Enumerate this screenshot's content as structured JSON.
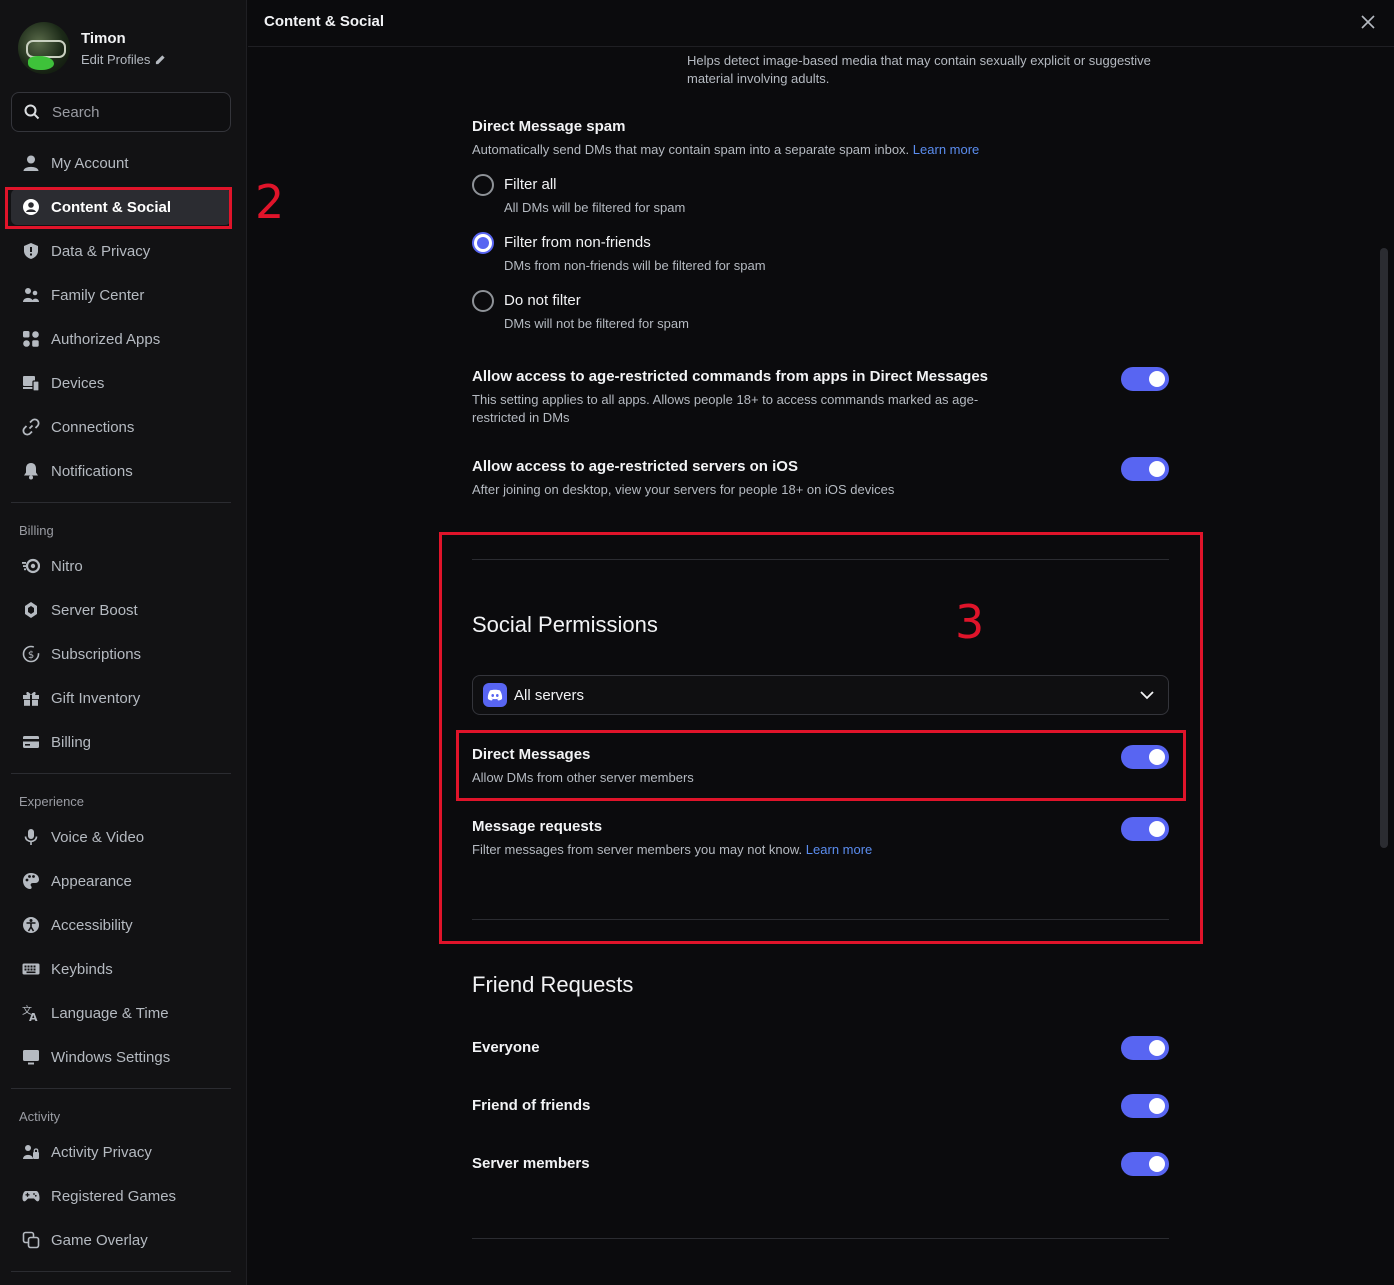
{
  "profile": {
    "name": "Timon",
    "edit_label": "Edit Profiles"
  },
  "search": {
    "placeholder": "Search"
  },
  "nav": {
    "user_items": [
      {
        "label": "My Account",
        "icon": "person-icon"
      },
      {
        "label": "Content & Social",
        "icon": "content-social-icon",
        "active": true
      },
      {
        "label": "Data & Privacy",
        "icon": "shield-icon"
      },
      {
        "label": "Family Center",
        "icon": "family-icon"
      },
      {
        "label": "Authorized Apps",
        "icon": "apps-icon"
      },
      {
        "label": "Devices",
        "icon": "devices-icon"
      },
      {
        "label": "Connections",
        "icon": "link-icon"
      },
      {
        "label": "Notifications",
        "icon": "bell-icon"
      }
    ],
    "billing_label": "Billing",
    "billing_items": [
      {
        "label": "Nitro",
        "icon": "nitro-icon"
      },
      {
        "label": "Server Boost",
        "icon": "boost-icon"
      },
      {
        "label": "Subscriptions",
        "icon": "subscriptions-icon"
      },
      {
        "label": "Gift Inventory",
        "icon": "gift-icon"
      },
      {
        "label": "Billing",
        "icon": "card-icon"
      }
    ],
    "experience_label": "Experience",
    "experience_items": [
      {
        "label": "Voice & Video",
        "icon": "mic-icon"
      },
      {
        "label": "Appearance",
        "icon": "palette-icon"
      },
      {
        "label": "Accessibility",
        "icon": "accessibility-icon"
      },
      {
        "label": "Keybinds",
        "icon": "keyboard-icon"
      },
      {
        "label": "Language & Time",
        "icon": "language-icon"
      },
      {
        "label": "Windows Settings",
        "icon": "monitor-icon"
      }
    ],
    "activity_label": "Activity",
    "activity_items": [
      {
        "label": "Activity Privacy",
        "icon": "activity-icon"
      },
      {
        "label": "Registered Games",
        "icon": "gamepad-icon"
      },
      {
        "label": "Game Overlay",
        "icon": "overlay-icon"
      }
    ]
  },
  "header": {
    "title": "Content & Social"
  },
  "content": {
    "top_desc": "Helps detect image-based media that may contain sexually explicit or suggestive material involving adults.",
    "dm_spam": {
      "title": "Direct Message spam",
      "desc": "Automatically send DMs that may contain spam into a separate spam inbox.",
      "learn_more": "Learn more",
      "options": [
        {
          "label": "Filter all",
          "desc": "All DMs will be filtered for spam",
          "selected": false
        },
        {
          "label": "Filter from non-friends",
          "desc": "DMs from non-friends will be filtered for spam",
          "selected": true
        },
        {
          "label": "Do not filter",
          "desc": "DMs will not be filtered for spam",
          "selected": false
        }
      ]
    },
    "age_commands": {
      "title": "Allow access to age-restricted commands from apps in Direct Messages",
      "desc": "This setting applies to all apps. Allows people 18+ to access commands marked as age-restricted in DMs",
      "enabled": true
    },
    "age_servers": {
      "title": "Allow access to age-restricted servers on iOS",
      "desc": "After joining on desktop, view your servers for people 18+ on iOS devices",
      "enabled": true
    },
    "social_permissions": {
      "title": "Social Permissions",
      "dropdown_value": "All servers",
      "direct_messages": {
        "title": "Direct Messages",
        "desc": "Allow DMs from other server members",
        "enabled": true
      },
      "message_requests": {
        "title": "Message requests",
        "desc": "Filter messages from server members you may not know.",
        "learn_more": "Learn more",
        "enabled": true
      }
    },
    "friend_requests": {
      "title": "Friend Requests",
      "items": [
        {
          "label": "Everyone",
          "enabled": true
        },
        {
          "label": "Friend of friends",
          "enabled": true
        },
        {
          "label": "Server members",
          "enabled": true
        }
      ]
    }
  },
  "annotations": {
    "step2": "2",
    "step3": "3"
  },
  "colors": {
    "accent": "#5865f2",
    "annotation": "#e0142a",
    "link": "#5b8def",
    "background": "#0b0b0d",
    "sidebar": "#121214"
  }
}
